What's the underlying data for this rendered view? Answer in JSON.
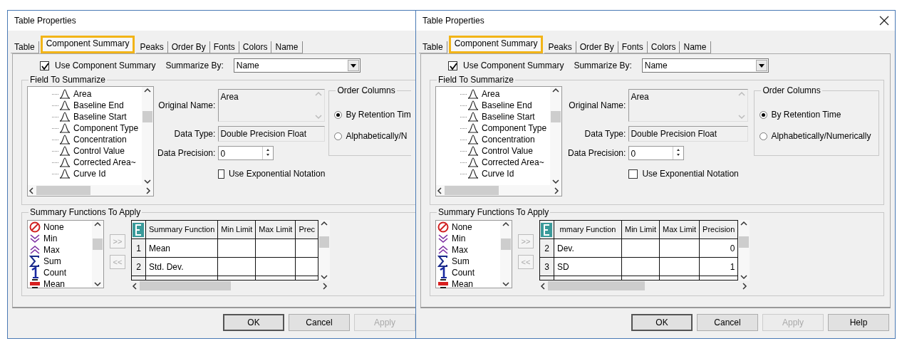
{
  "dialogs": [
    {
      "title": "Table Properties",
      "close_shown": false,
      "cut_right": true,
      "tabs": [
        {
          "label": "Table",
          "selected": false,
          "highlighted": false
        },
        {
          "label": "Component Summary",
          "selected": true,
          "highlighted": true
        },
        {
          "label": "Peaks",
          "selected": false,
          "highlighted": false
        },
        {
          "label": "Order By",
          "selected": false,
          "highlighted": false
        },
        {
          "label": "Fonts",
          "selected": false,
          "highlighted": false
        },
        {
          "label": "Colors",
          "selected": false,
          "highlighted": false
        },
        {
          "label": "Name",
          "selected": false,
          "highlighted": false
        }
      ],
      "use_component_summary": {
        "label": "Use Component Summary",
        "checked": true
      },
      "summarize_by": {
        "label": "Summarize By:",
        "value": "Name"
      },
      "field_group": {
        "title": "Field To Summarize",
        "tree_items": [
          "Area",
          "Baseline End",
          "Baseline Start",
          "Component Type",
          "Concentration",
          "Control Value",
          "Corrected Area~",
          "Curve Id"
        ],
        "original_name": {
          "label": "Original Name:",
          "value": "Area"
        },
        "data_type": {
          "label": "Data Type:",
          "value": "Double Precision Float"
        },
        "data_precision": {
          "label": "Data Precision:",
          "value": "0"
        },
        "exponential": {
          "label": "Use Exponential Notation",
          "checked": false
        },
        "order_columns": {
          "title": "Order Columns",
          "options": [
            {
              "label": "By Retention Tim",
              "selected": true
            },
            {
              "label": "Alphabetically/N",
              "selected": false
            }
          ]
        }
      },
      "summary_group": {
        "title": "Summary Functions To Apply",
        "functions": [
          {
            "label": "None",
            "kind": "none"
          },
          {
            "label": "Min",
            "kind": "min"
          },
          {
            "label": "Max",
            "kind": "max"
          },
          {
            "label": "Sum",
            "kind": "sum"
          },
          {
            "label": "Count",
            "kind": "count"
          },
          {
            "label": "Mean",
            "kind": "mean"
          }
        ],
        "add_label": ">>",
        "remove_label": "<<",
        "columns": [
          {
            "label": "Summary Function",
            "kind": "function"
          },
          {
            "label": "Min Limit",
            "kind": "min"
          },
          {
            "label": "Max Limit",
            "kind": "max"
          },
          {
            "label": "Prec",
            "kind": "precision"
          }
        ],
        "rows": [
          {
            "number": "1",
            "function": "Mean"
          },
          {
            "number": "2",
            "function": "Std. Dev."
          }
        ]
      },
      "buttons": [
        {
          "label": "OK",
          "default": true,
          "disabled": false
        },
        {
          "label": "Cancel",
          "default": false,
          "disabled": false
        },
        {
          "label": "Apply",
          "default": false,
          "disabled": true
        }
      ]
    },
    {
      "title": "Table Properties",
      "close_shown": true,
      "cut_right": false,
      "tabs": [
        {
          "label": "Table",
          "selected": false,
          "highlighted": false
        },
        {
          "label": "Component Summary",
          "selected": true,
          "highlighted": true
        },
        {
          "label": "Peaks",
          "selected": false,
          "highlighted": false
        },
        {
          "label": "Order By",
          "selected": false,
          "highlighted": false
        },
        {
          "label": "Fonts",
          "selected": false,
          "highlighted": false
        },
        {
          "label": "Colors",
          "selected": false,
          "highlighted": false
        },
        {
          "label": "Name",
          "selected": false,
          "highlighted": false
        }
      ],
      "use_component_summary": {
        "label": "Use Component Summary",
        "checked": true
      },
      "summarize_by": {
        "label": "Summarize By:",
        "value": "Name"
      },
      "field_group": {
        "title": "Field To Summarize",
        "tree_items": [
          "Area",
          "Baseline End",
          "Baseline Start",
          "Component Type",
          "Concentration",
          "Control Value",
          "Corrected Area~",
          "Curve Id"
        ],
        "original_name": {
          "label": "Original Name:",
          "value": "Area"
        },
        "data_type": {
          "label": "Data Type:",
          "value": "Double Precision Float"
        },
        "data_precision": {
          "label": "Data Precision:",
          "value": "0"
        },
        "exponential": {
          "label": "Use Exponential Notation",
          "checked": false
        },
        "order_columns": {
          "title": "Order Columns",
          "options": [
            {
              "label": "By Retention Time",
              "selected": true
            },
            {
              "label": "Alphabetically/Numerically",
              "selected": false
            }
          ]
        }
      },
      "summary_group": {
        "title": "Summary Functions To Apply",
        "functions": [
          {
            "label": "None",
            "kind": "none"
          },
          {
            "label": "Min",
            "kind": "min"
          },
          {
            "label": "Max",
            "kind": "max"
          },
          {
            "label": "Sum",
            "kind": "sum"
          },
          {
            "label": "Count",
            "kind": "count"
          },
          {
            "label": "Mean",
            "kind": "mean"
          }
        ],
        "add_label": ">>",
        "remove_label": "<<",
        "columns": [
          {
            "label": "mmary Function",
            "kind": "function"
          },
          {
            "label": "Min Limit",
            "kind": "min"
          },
          {
            "label": "Max Limit",
            "kind": "max"
          },
          {
            "label": "Precision",
            "kind": "precision"
          }
        ],
        "rows": [
          {
            "number": "2",
            "function": "Dev.",
            "precision": "0"
          },
          {
            "number": "3",
            "function": "SD",
            "precision": "1"
          }
        ]
      },
      "buttons": [
        {
          "label": "OK",
          "default": true,
          "disabled": false
        },
        {
          "label": "Cancel",
          "default": false,
          "disabled": false
        },
        {
          "label": "Apply",
          "default": false,
          "disabled": true
        },
        {
          "label": "Help",
          "default": false,
          "disabled": false
        }
      ]
    }
  ]
}
